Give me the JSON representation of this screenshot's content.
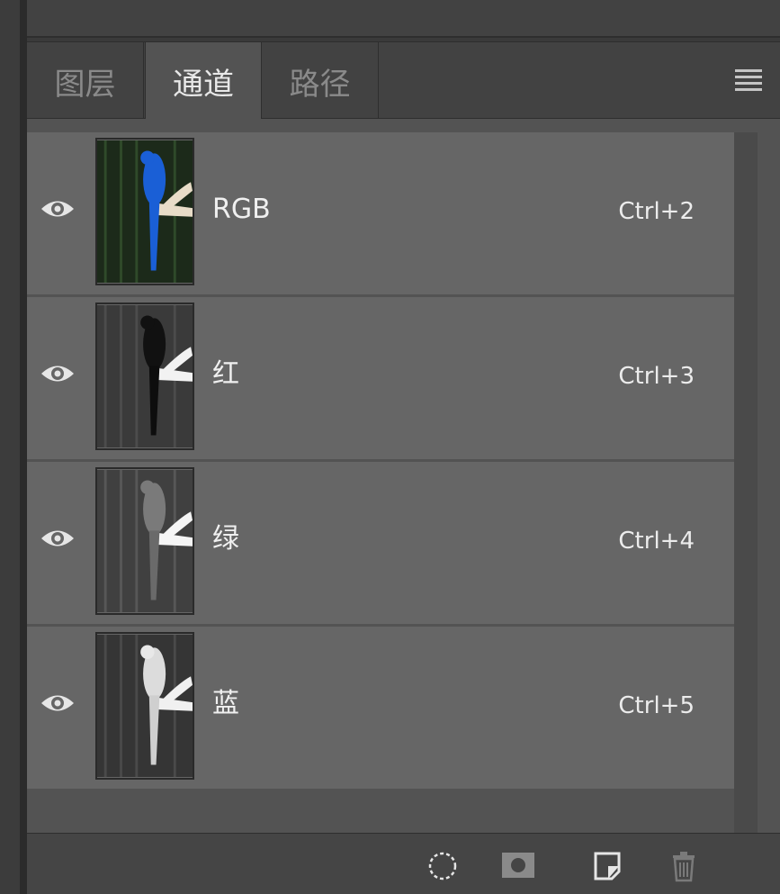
{
  "panel": {
    "tabs": [
      {
        "label": "图层"
      },
      {
        "label": "通道"
      },
      {
        "label": "路径"
      }
    ],
    "active_tab": "通道"
  },
  "channels": [
    {
      "name": "RGB",
      "shortcut": "Ctrl+2"
    },
    {
      "name": "红",
      "shortcut": "Ctrl+3"
    },
    {
      "name": "绿",
      "shortcut": "Ctrl+4"
    },
    {
      "name": "蓝",
      "shortcut": "Ctrl+5"
    }
  ],
  "footer": {
    "icons": [
      "load-selection-icon",
      "save-mask-icon",
      "new-channel-icon",
      "delete-icon"
    ]
  },
  "colors": {
    "panel_bg": "#535353",
    "row_bg": "#666666",
    "rgb_bird": "#1a5fd6"
  }
}
